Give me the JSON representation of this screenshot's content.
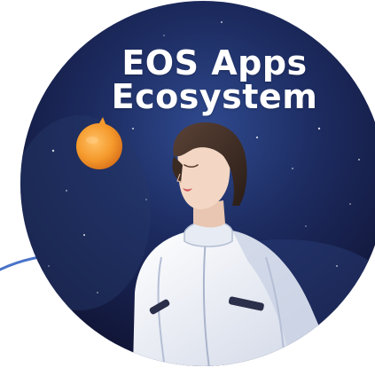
{
  "title": {
    "line1": "EOS Apps",
    "line2": "Ecosystem"
  },
  "colors": {
    "space_dark": "#0f1230",
    "space_mid": "#1c2a5e",
    "space_light": "#3d5a9e",
    "planet": "#f59a2c",
    "suit": "#eef1f7",
    "hair": "#3a2a22",
    "skin": "#f3d7c4",
    "swoosh": "#4a73c9"
  }
}
